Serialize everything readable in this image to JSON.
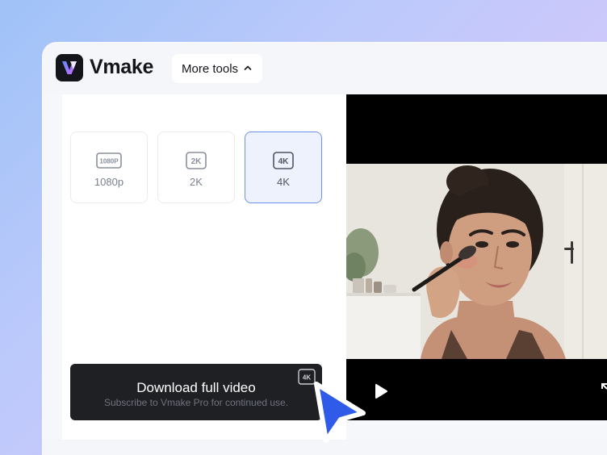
{
  "app": {
    "name": "Vmake",
    "logo_glyph": "V",
    "brand_colors": {
      "dark": "#14151a",
      "accent": "#6f91ef",
      "logo_gradient_start": "#5b8bff",
      "logo_gradient_end": "#d26bff"
    }
  },
  "header": {
    "more_tools_label": "More tools",
    "more_tools_icon": "chevron-up-icon"
  },
  "resolution_options": [
    {
      "badge": "1080P",
      "label": "1080p",
      "selected": false
    },
    {
      "badge": "2K",
      "label": "2K",
      "selected": false
    },
    {
      "badge": "4K",
      "label": "4K",
      "selected": true
    }
  ],
  "download": {
    "title": "Download full video",
    "subtitle": "Subscribe to Vmake Pro for continued use.",
    "badge": "4K"
  },
  "video": {
    "play_icon": "play-icon",
    "fullscreen_icon": "expand-icon",
    "content": "woman-applying-blush-with-brush"
  },
  "cursor": {
    "color": "#2f5be8",
    "icon": "pointer-cursor-icon"
  }
}
